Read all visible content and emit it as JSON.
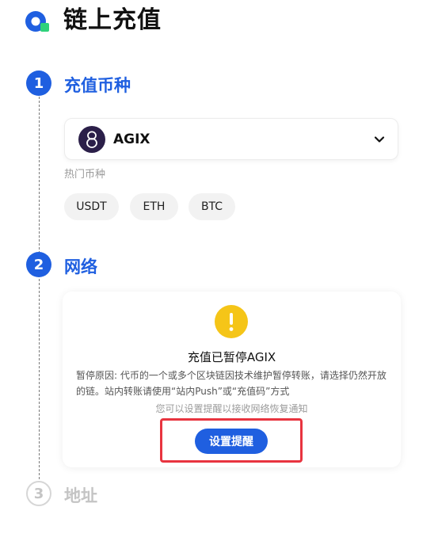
{
  "header": {
    "title": "链上充值",
    "logo_icon": "app-logo-icon"
  },
  "steps": [
    {
      "number": "1",
      "title": "充值币种",
      "state": "active"
    },
    {
      "number": "2",
      "title": "网络",
      "state": "active"
    },
    {
      "number": "3",
      "title": "地址",
      "state": "inactive"
    }
  ],
  "coin_select": {
    "selected": "AGIX",
    "icon": "agix-coin-icon",
    "dropdown_icon": "chevron-down-icon"
  },
  "hot_coins": {
    "label": "热门币种",
    "items": [
      "USDT",
      "ETH",
      "BTC"
    ]
  },
  "network_card": {
    "icon": "warning-icon",
    "title": "充值已暂停AGIX",
    "reason": "暂停原因: 代币的一个或多个区块链因技术维护暂停转账，请选择仍然开放的链。站内转账请使用“站内Push”或“充值码”方式",
    "notice": "您可以设置提醒以接收网络恢复通知",
    "button_label": "设置提醒"
  },
  "colors": {
    "primary": "#1f5fe0",
    "warning": "#f5c518",
    "highlight": "#e8343f",
    "inactive": "#c4c4c4"
  }
}
